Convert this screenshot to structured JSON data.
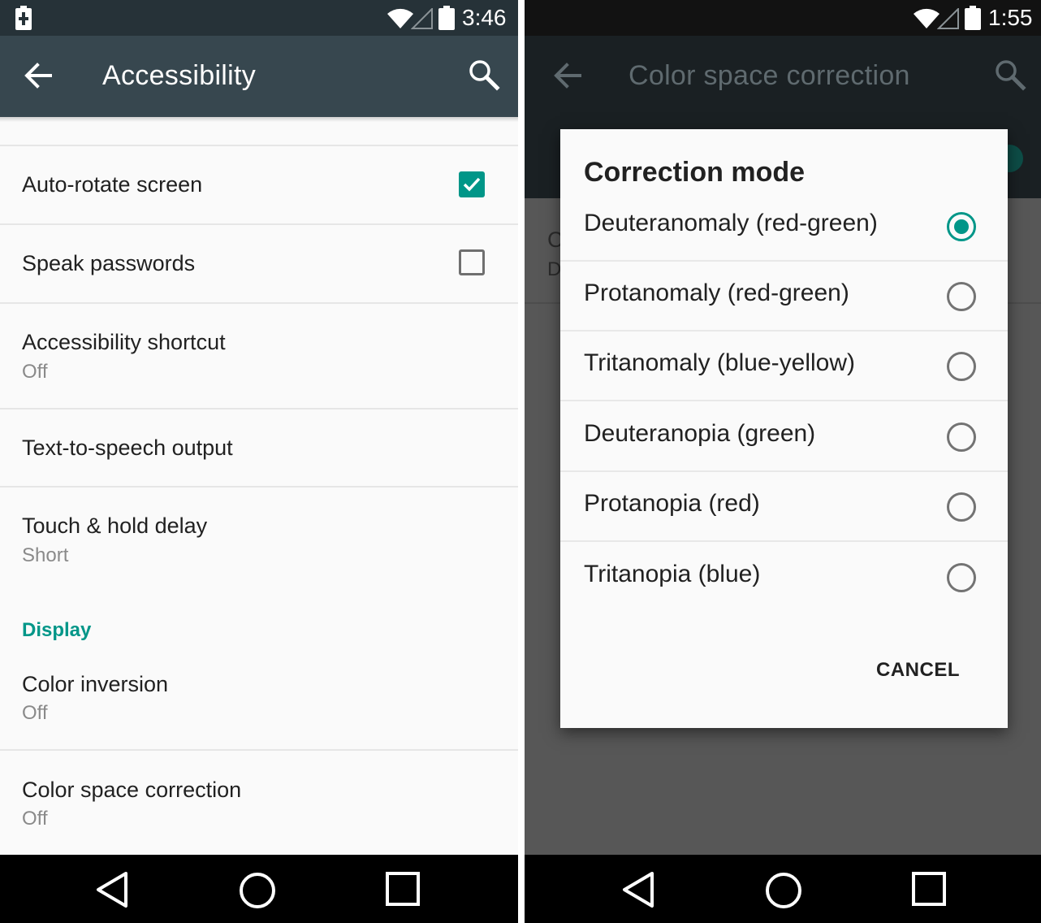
{
  "left_screen": {
    "status_bar": {
      "time": "3:46"
    },
    "app_bar": {
      "title": "Accessibility"
    },
    "rows": [
      {
        "title": "Auto-rotate screen",
        "checked": true
      },
      {
        "title": "Speak passwords",
        "checked": false
      },
      {
        "title": "Accessibility shortcut",
        "summary": "Off"
      },
      {
        "title": "Text-to-speech output"
      },
      {
        "title": "Touch & hold delay",
        "summary": "Short"
      }
    ],
    "section_header": "Display",
    "display_rows": [
      {
        "title": "Color inversion",
        "summary": "Off"
      },
      {
        "title": "Color space correction",
        "summary": "Off"
      }
    ]
  },
  "right_screen": {
    "status_bar": {
      "time": "1:55"
    },
    "app_bar": {
      "title": "Color space correction"
    },
    "background_fragment": {
      "title_initial": "C",
      "summary_initial": "D"
    },
    "dialog": {
      "title": "Correction mode",
      "options": [
        {
          "label": "Deuteranomaly (red-green)",
          "selected": true
        },
        {
          "label": "Protanomaly (red-green)",
          "selected": false
        },
        {
          "label": "Tritanomaly (blue-yellow)",
          "selected": false
        },
        {
          "label": "Deuteranopia (green)",
          "selected": false
        },
        {
          "label": "Protanopia (red)",
          "selected": false
        },
        {
          "label": "Tritanopia (blue)",
          "selected": false
        }
      ],
      "cancel_label": "CANCEL"
    }
  },
  "colors": {
    "accent": "#009688",
    "app_bar": "#37474f",
    "status_bar": "#263238"
  },
  "icons": {
    "status": [
      "battery-charging-icon",
      "wifi-icon",
      "signal-icon",
      "battery-icon"
    ],
    "app_bar": [
      "back-arrow-icon",
      "search-icon"
    ],
    "nav": [
      "back-triangle-icon",
      "home-circle-icon",
      "recents-square-icon"
    ]
  }
}
